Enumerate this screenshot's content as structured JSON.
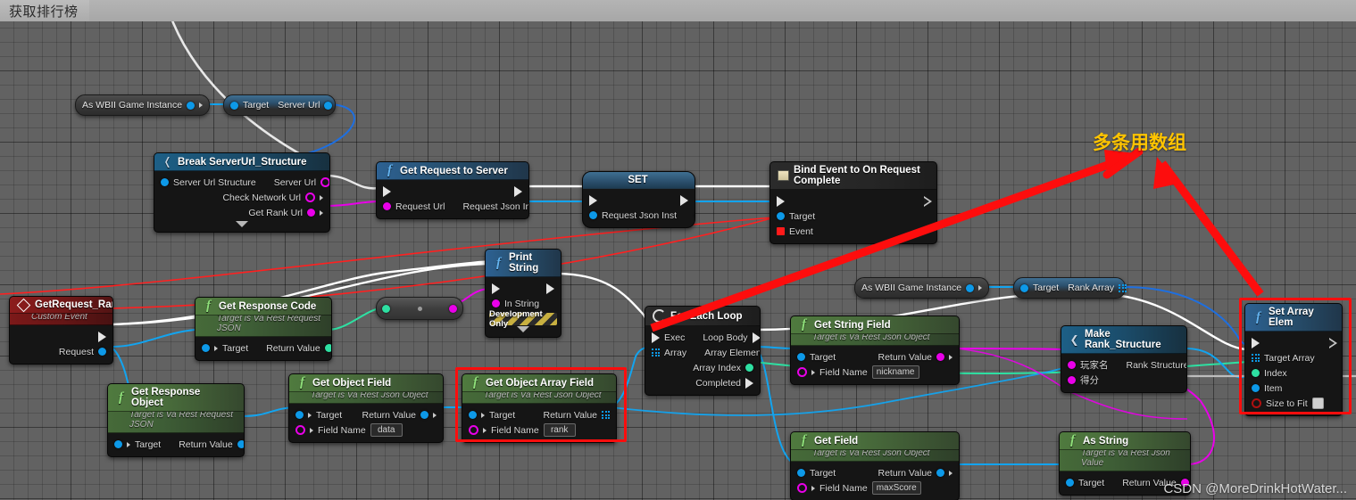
{
  "window": {
    "tab_title": "获取排行榜"
  },
  "annotations": {
    "array_note": "多条用数组",
    "watermark": "CSDN @MoreDrinkHotWater..."
  },
  "colors": {
    "graph_background": "#626262",
    "exec_wire": "#ffffff",
    "object_wire": "#0d99e8",
    "string_wire": "#e900e9",
    "int_wire": "#2ee0a2",
    "delegate_wire": "#ff2020",
    "highlight_box": "#fd0d0d",
    "annotation": "#ffc400"
  },
  "pills": [
    {
      "name": "as-wbii-game-instance-1",
      "label": "As WBII Game Instance",
      "out_pin": "blue"
    },
    {
      "name": "get-server-url",
      "in_label": "Target",
      "out_label": "Server Url",
      "out_pin": "blue"
    },
    {
      "name": "as-wbii-game-instance-2",
      "label": "As WBII Game Instance",
      "out_pin": "blue"
    },
    {
      "name": "get-rank-array",
      "in_label": "Target",
      "out_label": "Rank Array",
      "out_pin": "array"
    }
  ],
  "nodes": {
    "break_server_url": {
      "title": "Break ServerUrl_Structure",
      "inputs": [
        {
          "label": "Server Url Structure",
          "pin": "blue"
        }
      ],
      "outputs": [
        {
          "label": "Server Url",
          "pin": "hollowmag"
        },
        {
          "label": "Check Network Url",
          "pin": "hollowmag"
        },
        {
          "label": "Get Rank Url",
          "pin": "magenta"
        }
      ]
    },
    "get_request_to_server": {
      "title": "Get Request to Server",
      "inputs": [
        {
          "label": "Request Url",
          "pin": "magenta"
        }
      ],
      "outputs": [
        {
          "label": "Request Json Inst",
          "pin": "blue"
        }
      ]
    },
    "set_node": {
      "title": "SET",
      "inputs": [
        {
          "label": "Request Json Inst",
          "pin": "blue"
        }
      ],
      "outputs": [
        {
          "label": "",
          "pin": "blue"
        }
      ]
    },
    "bind_event": {
      "title": "Bind Event to On Request Complete",
      "inputs": [
        {
          "label": "Target",
          "pin": "blue"
        },
        {
          "label": "Event",
          "pin": "red"
        }
      ]
    },
    "print_string": {
      "title": "Print String",
      "inputs": [
        {
          "label": "In String",
          "pin": "magenta"
        }
      ],
      "dev_only": "Development Only"
    },
    "get_request_rank": {
      "title": "GetRequest_Rank",
      "subtitle": "Custom Event",
      "outputs": [
        {
          "label": "Request",
          "pin": "blue"
        }
      ]
    },
    "get_response_code": {
      "title": "Get Response Code",
      "subtitle": "Target is Va Rest Request JSON",
      "inputs": [
        {
          "label": "Target",
          "pin": "blue"
        }
      ],
      "outputs": [
        {
          "label": "Return Value",
          "pin": "green"
        }
      ]
    },
    "get_response_object": {
      "title": "Get Response Object",
      "subtitle": "Target is Va Rest Request JSON",
      "inputs": [
        {
          "label": "Target",
          "pin": "blue"
        }
      ],
      "outputs": [
        {
          "label": "Return Value",
          "pin": "blue"
        }
      ]
    },
    "get_object_field": {
      "title": "Get Object Field",
      "subtitle": "Target is Va Rest Json Object",
      "inputs": [
        {
          "label": "Target",
          "pin": "blue"
        }
      ],
      "field_label": "Field Name",
      "field_value": "data",
      "outputs": [
        {
          "label": "Return Value",
          "pin": "blue"
        }
      ]
    },
    "get_object_array_field": {
      "title": "Get Object Array Field",
      "subtitle": "Target is Va Rest Json Object",
      "inputs": [
        {
          "label": "Target",
          "pin": "blue"
        }
      ],
      "field_label": "Field Name",
      "field_value": "rank",
      "outputs": [
        {
          "label": "Return Value",
          "pin": "array"
        }
      ],
      "highlighted": true
    },
    "for_each_loop": {
      "title": "For Each Loop",
      "inputs": [
        {
          "label": "Exec",
          "pin": "exec"
        },
        {
          "label": "Array",
          "pin": "array"
        }
      ],
      "outputs": [
        {
          "label": "Loop Body",
          "pin": "exec"
        },
        {
          "label": "Array Element",
          "pin": "blue"
        },
        {
          "label": "Array Index",
          "pin": "green"
        },
        {
          "label": "Completed",
          "pin": "exec"
        }
      ]
    },
    "get_string_field": {
      "title": "Get String Field",
      "subtitle": "Target is Va Rest Json Object",
      "inputs": [
        {
          "label": "Target",
          "pin": "blue"
        }
      ],
      "field_label": "Field Name",
      "field_value": "nickname",
      "outputs": [
        {
          "label": "Return Value",
          "pin": "magenta"
        }
      ]
    },
    "get_field": {
      "title": "Get Field",
      "subtitle": "Target is Va Rest Json Object",
      "inputs": [
        {
          "label": "Target",
          "pin": "blue"
        }
      ],
      "field_label": "Field Name",
      "field_value": "maxScore",
      "outputs": [
        {
          "label": "Return Value",
          "pin": "blue"
        }
      ]
    },
    "as_string": {
      "title": "As String",
      "subtitle": "Target is Va Rest Json Value",
      "inputs": [
        {
          "label": "Target",
          "pin": "blue"
        }
      ],
      "outputs": [
        {
          "label": "Return Value",
          "pin": "magenta"
        }
      ]
    },
    "make_rank_structure": {
      "title": "Make Rank_Structure",
      "inputs": [
        {
          "label": "玩家名",
          "pin": "magenta"
        },
        {
          "label": "得分",
          "pin": "magenta"
        }
      ],
      "outputs": [
        {
          "label": "Rank Structure",
          "pin": "blue"
        }
      ]
    },
    "set_array_elem": {
      "title": "Set Array Elem",
      "inputs": [
        {
          "label": "Target Array",
          "pin": "array"
        },
        {
          "label": "Index",
          "pin": "green"
        },
        {
          "label": "Item",
          "pin": "blue"
        },
        {
          "label": "Size to Fit",
          "pin": "hollowred",
          "checkbox": true
        }
      ],
      "highlighted": true
    }
  }
}
